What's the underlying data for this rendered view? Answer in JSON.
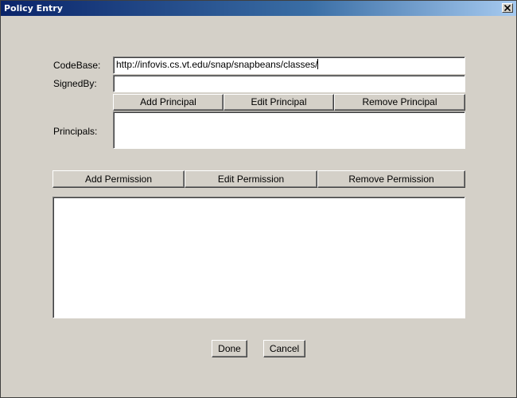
{
  "window": {
    "title": "Policy Entry"
  },
  "form": {
    "codebase_label": "CodeBase:",
    "codebase_value": "http://infovis.cs.vt.edu/snap/snapbeans/classes/",
    "signedby_label": "SignedBy:",
    "signedby_value": "",
    "principals_label": "Principals:"
  },
  "principal_buttons": {
    "add": "Add Principal",
    "edit": "Edit Principal",
    "remove": "Remove Principal"
  },
  "permission_buttons": {
    "add": "Add Permission",
    "edit": "Edit Permission",
    "remove": "Remove Permission"
  },
  "footer": {
    "done": "Done",
    "cancel": "Cancel"
  },
  "icons": {
    "close": "close-icon"
  }
}
